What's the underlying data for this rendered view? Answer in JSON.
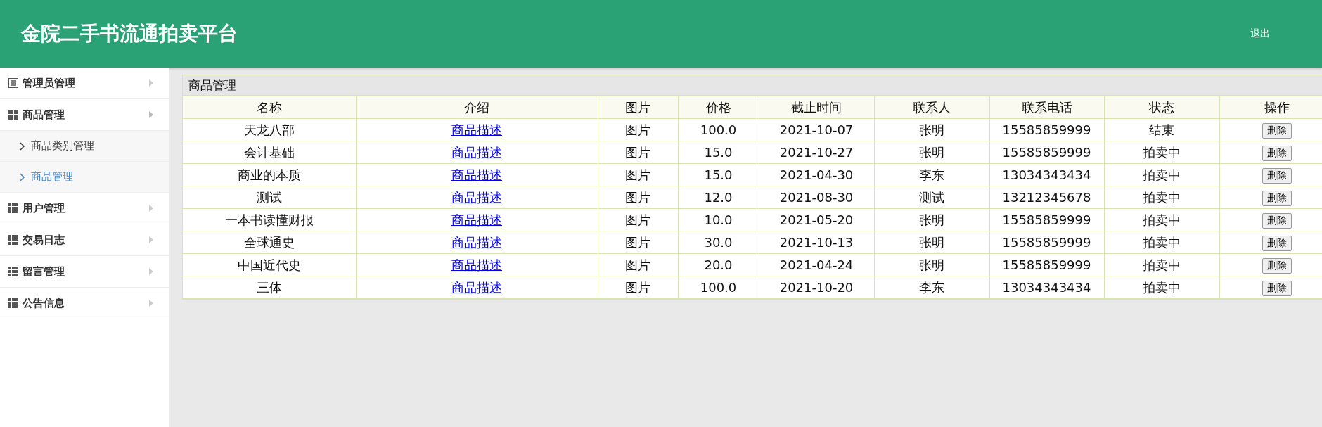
{
  "header": {
    "title": "金院二手书流通拍卖平台",
    "logout": "退出"
  },
  "sidebar": {
    "items": [
      {
        "label": "管理员管理",
        "expanded": false
      },
      {
        "label": "商品管理",
        "expanded": true,
        "children": [
          {
            "label": "商品类别管理",
            "selected": false
          },
          {
            "label": "商品管理",
            "selected": true
          }
        ]
      },
      {
        "label": "用户管理",
        "expanded": false
      },
      {
        "label": "交易日志",
        "expanded": false
      },
      {
        "label": "留言管理",
        "expanded": false
      },
      {
        "label": "公告信息",
        "expanded": false
      }
    ]
  },
  "panel": {
    "title": "商品管理",
    "table": {
      "columns": [
        "名称",
        "介绍",
        "图片",
        "价格",
        "截止时间",
        "联系人",
        "联系电话",
        "状态",
        "操作"
      ],
      "rows": [
        {
          "name": "天龙八部",
          "intro": "商品描述",
          "image": "图片",
          "price": "100.0",
          "deadline": "2021-10-07",
          "contact": "张明",
          "phone": "15585859999",
          "status": "结束",
          "action": "删除"
        },
        {
          "name": "会计基础",
          "intro": "商品描述",
          "image": "图片",
          "price": "15.0",
          "deadline": "2021-10-27",
          "contact": "张明",
          "phone": "15585859999",
          "status": "拍卖中",
          "action": "删除"
        },
        {
          "name": "商业的本质",
          "intro": "商品描述",
          "image": "图片",
          "price": "15.0",
          "deadline": "2021-04-30",
          "contact": "李东",
          "phone": "13034343434",
          "status": "拍卖中",
          "action": "删除"
        },
        {
          "name": "测试",
          "intro": "商品描述",
          "image": "图片",
          "price": "12.0",
          "deadline": "2021-08-30",
          "contact": "测试",
          "phone": "13212345678",
          "status": "拍卖中",
          "action": "删除"
        },
        {
          "name": "一本书读懂财报",
          "intro": "商品描述",
          "image": "图片",
          "price": "10.0",
          "deadline": "2021-05-20",
          "contact": "张明",
          "phone": "15585859999",
          "status": "拍卖中",
          "action": "删除"
        },
        {
          "name": "全球通史",
          "intro": "商品描述",
          "image": "图片",
          "price": "30.0",
          "deadline": "2021-10-13",
          "contact": "张明",
          "phone": "15585859999",
          "status": "拍卖中",
          "action": "删除"
        },
        {
          "name": "中国近代史",
          "intro": "商品描述",
          "image": "图片",
          "price": "20.0",
          "deadline": "2021-04-24",
          "contact": "张明",
          "phone": "15585859999",
          "status": "拍卖中",
          "action": "删除"
        },
        {
          "name": "三体",
          "intro": "商品描述",
          "image": "图片",
          "price": "100.0",
          "deadline": "2021-10-20",
          "contact": "李东",
          "phone": "13034343434",
          "status": "拍卖中",
          "action": "删除"
        }
      ]
    }
  }
}
